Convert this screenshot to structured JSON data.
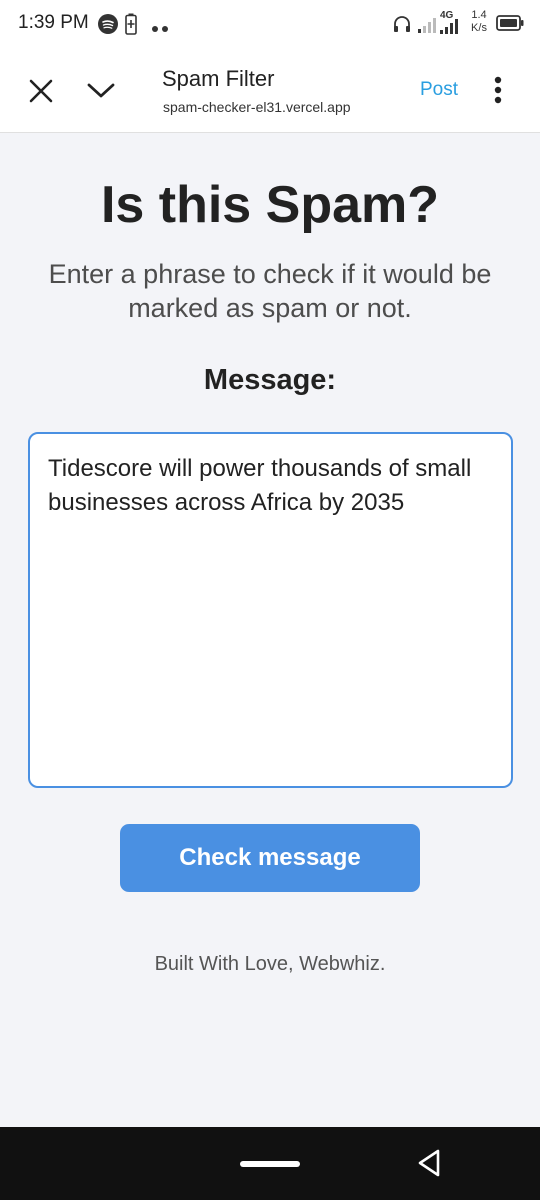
{
  "status_bar": {
    "time": "1:39 PM",
    "network_type": "4G",
    "speed_value": "1.4",
    "speed_unit": "K/s",
    "icons": [
      "spotify-icon",
      "battery-saver-icon",
      "more-dots-icon",
      "headphones-icon",
      "signal-icon",
      "signal-icon",
      "battery-icon"
    ]
  },
  "toolbar": {
    "title": "Spam Filter",
    "url": "spam-checker-el31.vercel.app",
    "post_label": "Post",
    "icons": [
      "close-icon",
      "chevron-down-icon",
      "more-vert-icon"
    ]
  },
  "main": {
    "heading": "Is this Spam?",
    "subtitle": "Enter a phrase to check if it would be marked as spam or not.",
    "message_label": "Message:",
    "message_value": "Tidescore will power thousands of small businesses across Africa by 2035",
    "check_button_label": "Check message",
    "footer_text": "Built With Love, Webwhiz."
  },
  "colors": {
    "accent": "#4a90e2",
    "link": "#2a9ee0",
    "background": "#f3f4f8"
  }
}
